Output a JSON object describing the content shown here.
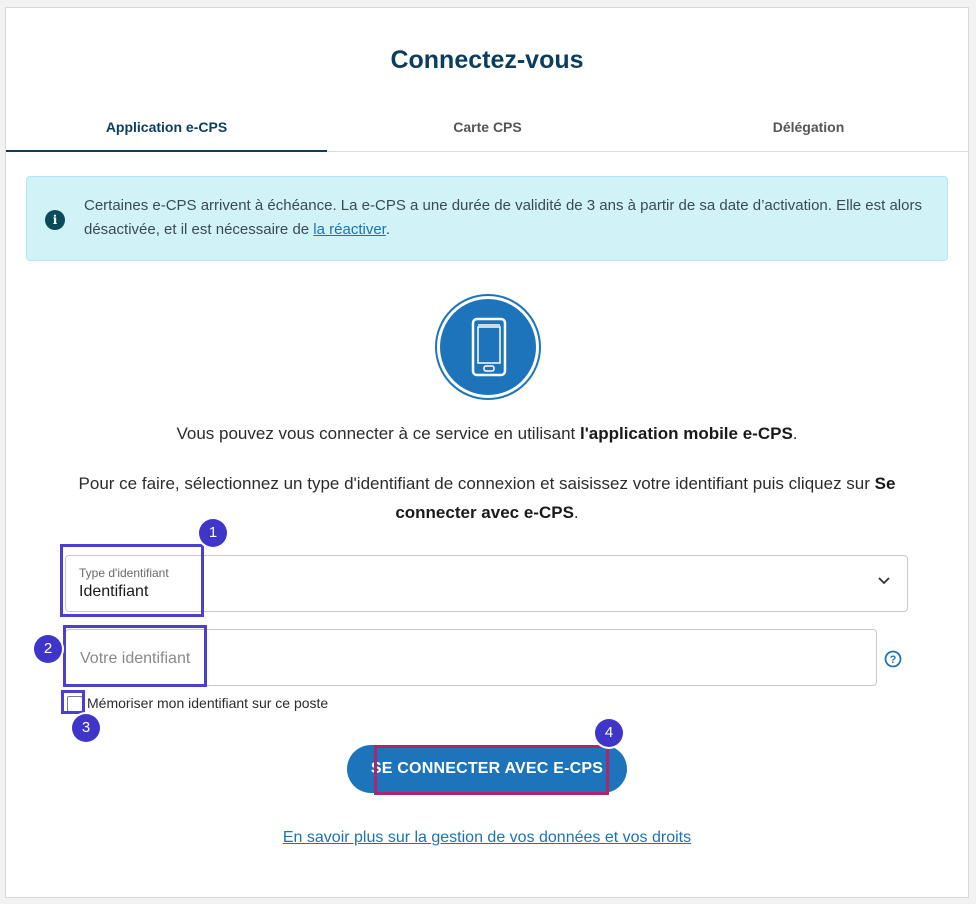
{
  "page": {
    "title": "Connectez-vous"
  },
  "tabs": [
    {
      "label": "Application e-CPS",
      "active": true
    },
    {
      "label": "Carte CPS",
      "active": false
    },
    {
      "label": "Délégation",
      "active": false
    }
  ],
  "alert": {
    "icon": "info-icon",
    "text_before": "Certaines e-CPS arrivent à échéance. La e-CPS a une durée de validité de 3 ans à partir de sa date d’activation. Elle est alors désactivée, et il est nécessaire de ",
    "link": "la réactiver",
    "text_after": "."
  },
  "phone_icon": "smartphone-icon",
  "intro": {
    "text_before": "Vous pouvez vous connecter à ce service en utilisant ",
    "bold": "l'application mobile e-CPS",
    "text_after": "."
  },
  "instructions": {
    "text_before": "Pour ce faire, sélectionnez un type d'identifiant de connexion et saisissez votre identifiant puis cliquez sur ",
    "bold": "Se connecter avec e-CPS",
    "text_after": "."
  },
  "form": {
    "type_label": "Type d'identifiant",
    "type_value": "Identifiant",
    "identifier_placeholder": "Votre identifiant",
    "identifier_value": "",
    "remember_label": "Mémoriser mon identifiant sur ce poste",
    "remember_checked": false,
    "submit_label": "SE CONNECTER AVEC E-CPS"
  },
  "footer_link": "En savoir plus sur la gestion de vos données et vos droits",
  "annotations": [
    "1",
    "2",
    "3",
    "4"
  ],
  "colors": {
    "primary": "#1e74bb",
    "title": "#0c3d5e",
    "alert_bg": "#d1f3f8",
    "annotation_blue": "#3f35c8",
    "annotation_pink": "#b0236e"
  }
}
